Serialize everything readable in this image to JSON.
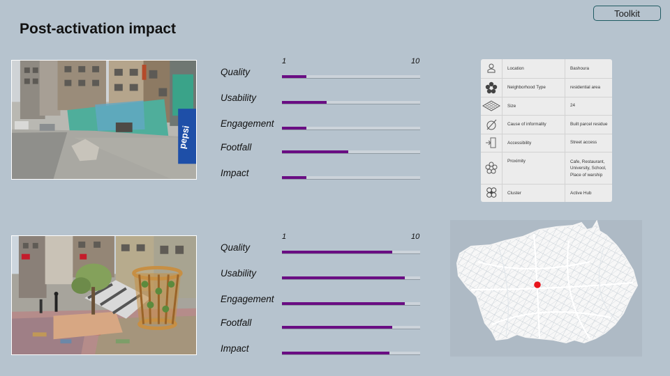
{
  "header": {
    "title": "Post-activation impact",
    "toolkit_label": "Toolkit"
  },
  "scale": {
    "min": "1",
    "max": "10"
  },
  "before": {
    "metrics": [
      {
        "label": "Quality",
        "value": 2.6
      },
      {
        "label": "Usability",
        "value": 3.9
      },
      {
        "label": "Engagement",
        "value": 2.6
      },
      {
        "label": "Footfall",
        "value": 5.3
      },
      {
        "label": "Impact",
        "value": 2.6
      }
    ],
    "photo": {
      "storefront_sign": "pepsi"
    }
  },
  "after": {
    "metrics": [
      {
        "label": "Quality",
        "value": 8.2
      },
      {
        "label": "Usability",
        "value": 9.0
      },
      {
        "label": "Engagement",
        "value": 9.0
      },
      {
        "label": "Footfall",
        "value": 8.2
      },
      {
        "label": "Impact",
        "value": 8.0
      }
    ]
  },
  "site_info": [
    {
      "icon": "person-pin-icon",
      "key": "Location",
      "value": "Bashoura"
    },
    {
      "icon": "flower-icon",
      "key": "Neighborhood Type",
      "value": "residential area"
    },
    {
      "icon": "grid-diamond-icon",
      "key": "Size",
      "value": "24"
    },
    {
      "icon": "slashed-circle-icon",
      "key": "Cause of informality",
      "value": "Built parcel residue"
    },
    {
      "icon": "entrance-icon",
      "key": "Accessibility",
      "value": "Street access"
    },
    {
      "icon": "flower-outline-icon",
      "key": "Proximity",
      "value": "Cafe, Restaurant, University, School, Place of warship"
    },
    {
      "icon": "cluster-icon",
      "key": "Cluster",
      "value": "Active Hub"
    }
  ],
  "colors": {
    "background": "#b6c3ce",
    "bar_fill": "#6a0d83",
    "map_marker": "#e8141b",
    "toolkit_border": "#1e5a62"
  }
}
